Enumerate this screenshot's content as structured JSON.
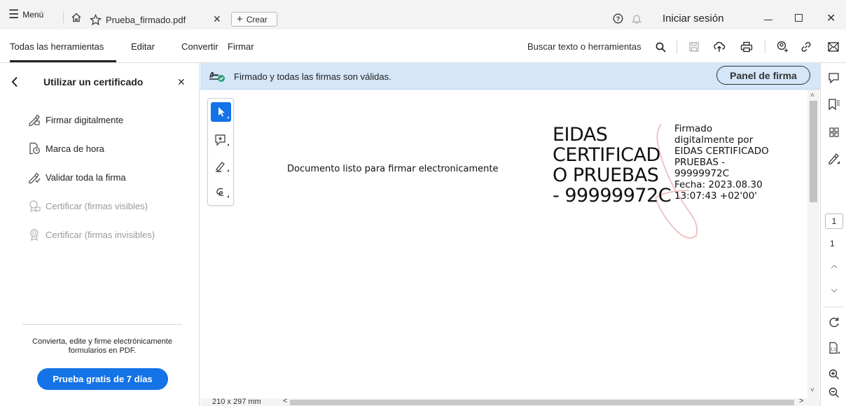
{
  "titlebar": {
    "menu_label": "Menú",
    "tab_title": "Prueba_firmado.pdf",
    "new_label": "Crear",
    "signin_label": "Iniciar sesión"
  },
  "toolbar": {
    "tabs": [
      "Todas las herramientas",
      "Editar",
      "Convertir",
      "Firmar"
    ],
    "search_label": "Buscar texto o herramientas"
  },
  "leftpanel": {
    "title": "Utilizar un certificado",
    "tools": [
      {
        "label": "Firmar digitalmente",
        "enabled": true,
        "icon": "sign-digital-icon"
      },
      {
        "label": "Marca de hora",
        "enabled": true,
        "icon": "timestamp-icon"
      },
      {
        "label": "Validar toda la firma",
        "enabled": true,
        "icon": "validate-signature-icon"
      },
      {
        "label": "Certificar (firmas visibles)",
        "enabled": false,
        "icon": "certify-visible-icon"
      },
      {
        "label": "Certificar (firmas invisibles)",
        "enabled": false,
        "icon": "certify-invisible-icon"
      }
    ],
    "promo_text": "Convierta, edite y firme electrónicamente formularios en PDF.",
    "trial_button": "Prueba gratis de 7 días"
  },
  "banner": {
    "status_text": "Firmado y todas las firmas son válidas.",
    "panel_button": "Panel de firma"
  },
  "document": {
    "body_text": "Documento listo para firmar electronicamente",
    "signature_name_lines": [
      "EIDAS",
      "CERTIFICAD",
      "O PRUEBAS",
      "- 99999972C"
    ],
    "signature_detail_lines": [
      "Firmado",
      "digitalmente por",
      "EIDAS CERTIFICADO",
      "PRUEBAS -",
      "99999972C",
      "Fecha: 2023.08.30",
      "13:07:43 +02'00'"
    ],
    "page_size": "210 x 297 mm"
  },
  "rightrail": {
    "page_input": "1",
    "page_total": "1"
  },
  "colors": {
    "accent": "#1473e6",
    "banner_bg": "#d4e6f8",
    "valid_green": "#2d9d78"
  }
}
